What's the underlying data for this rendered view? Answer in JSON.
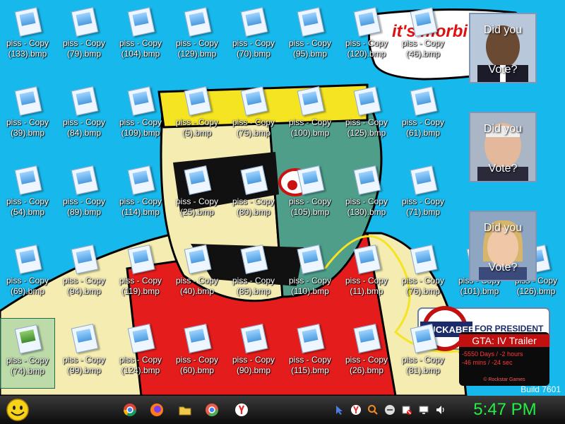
{
  "desktop_icons": [
    {
      "label": "piss - Copy (133).bmp"
    },
    {
      "label": "piss - Copy (79).bmp"
    },
    {
      "label": "piss - Copy (104).bmp"
    },
    {
      "label": "piss - Copy (129).bmp"
    },
    {
      "label": "piss - Copy (70).bmp"
    },
    {
      "label": "piss - Copy (95).bmp"
    },
    {
      "label": "piss - Copy (120).bmp"
    },
    {
      "label": "piss - Copy (46).bmp"
    },
    {
      "label": "piss - Copy (39).bmp"
    },
    {
      "label": "piss - Copy (84).bmp"
    },
    {
      "label": "piss - Copy (109).bmp"
    },
    {
      "label": "piss - Copy (5).bmp"
    },
    {
      "label": "piss - Copy (75).bmp"
    },
    {
      "label": "piss - Copy (100).bmp"
    },
    {
      "label": "piss - Copy (125).bmp"
    },
    {
      "label": "piss - Copy (61).bmp"
    },
    {
      "label": "piss - Copy (54).bmp"
    },
    {
      "label": "piss - Copy (89).bmp"
    },
    {
      "label": "piss - Copy (114).bmp"
    },
    {
      "label": "piss - Copy (25).bmp"
    },
    {
      "label": "piss - Copy (80).bmp"
    },
    {
      "label": "piss - Copy (105).bmp"
    },
    {
      "label": "piss - Copy (130).bmp"
    },
    {
      "label": "piss - Copy (71).bmp"
    },
    {
      "label": "piss - Copy (69).bmp"
    },
    {
      "label": "piss - Copy (94).bmp"
    },
    {
      "label": "piss - Copy (119).bmp"
    },
    {
      "label": "piss - Copy (40).bmp"
    },
    {
      "label": "piss - Copy (85).bmp"
    },
    {
      "label": "piss - Copy (110).bmp"
    },
    {
      "label": "piss - Copy (11).bmp"
    },
    {
      "label": "piss - Copy (76).bmp"
    },
    {
      "label": "piss - Copy (101).bmp"
    },
    {
      "label": "piss - Copy (126).bmp"
    },
    {
      "label": "piss - Copy (74).bmp",
      "selected": true
    },
    {
      "label": "piss - Copy (99).bmp"
    },
    {
      "label": "piss - Copy (124).bmp"
    },
    {
      "label": "piss - Copy (60).bmp"
    },
    {
      "label": "piss - Copy (90).bmp"
    },
    {
      "label": "piss - Copy (115).bmp"
    },
    {
      "label": "piss - Copy (26).bmp"
    },
    {
      "label": "piss - Copy (81).bmp"
    }
  ],
  "wallpaper": {
    "speech_bubble_text": "it's morbi",
    "banner_name": "HUCKABEE",
    "banner_tagline": "FOR PRESIDENT"
  },
  "vote_widgets": [
    {
      "question_top": "Did you",
      "question_bottom": "Vote?"
    },
    {
      "question_top": "Did you",
      "question_bottom": "Vote?"
    },
    {
      "question_top": "Did you",
      "question_bottom": "Vote?"
    }
  ],
  "gta_widget": {
    "title": "GTA: IV  Trailer",
    "countdown_line1": "-5550 Days / -2 hours",
    "countdown_line2": "-46 mins / -24 sec",
    "footer": "© Rockstar Games"
  },
  "build_text": "Build 7601",
  "taskbar": {
    "start_icon": "smiley-face-icon",
    "apps": [
      "chrome-icon",
      "firefox-icon",
      "folder-icon",
      "chromium-icon",
      "yandex-icon"
    ],
    "tray": [
      "cursor-icon",
      "yandex-tray-icon",
      "search-icon",
      "messenger-icon",
      "network-blocked-icon",
      "display-icon",
      "volume-icon"
    ],
    "clock": "5:47 PM"
  },
  "colors": {
    "desktop_bg": "#17b8ec",
    "clock": "#22ee44",
    "gta_red": "#c21010"
  }
}
